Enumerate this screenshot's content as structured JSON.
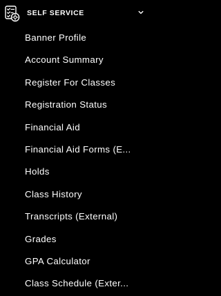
{
  "section": {
    "title": "SELF SERVICE",
    "icon": "checklist-settings-icon",
    "toggle_icon": "chevron-down-icon"
  },
  "menu": {
    "items": [
      {
        "label": "Banner Profile"
      },
      {
        "label": "Account Summary"
      },
      {
        "label": "Register For Classes"
      },
      {
        "label": "Registration Status"
      },
      {
        "label": "Financial Aid"
      },
      {
        "label": "Financial Aid Forms (E..."
      },
      {
        "label": "Holds"
      },
      {
        "label": "Class History"
      },
      {
        "label": "Transcripts (External)"
      },
      {
        "label": "Grades"
      },
      {
        "label": "GPA Calculator"
      },
      {
        "label": "Class Schedule (Exter..."
      }
    ]
  },
  "colors": {
    "background": "#000000",
    "text": "#ffffff"
  }
}
